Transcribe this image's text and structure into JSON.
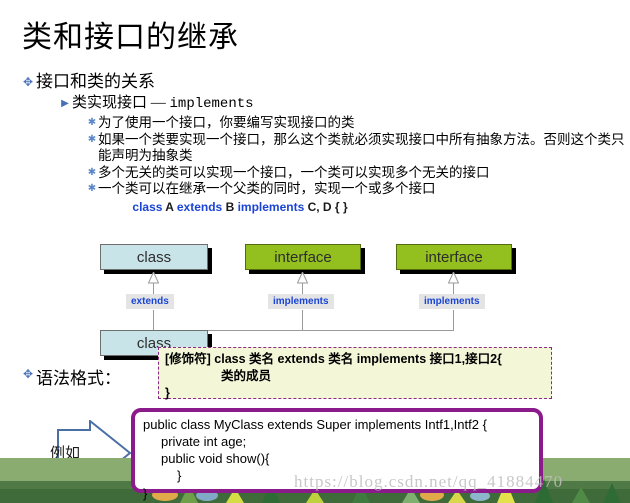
{
  "slide": {
    "title": "类和接口的继承"
  },
  "outline": {
    "level1": {
      "bullet_icon": "cross-arrow-bullet-icon",
      "text": "接口和类的关系"
    },
    "level2": {
      "bullet_icon": "triangle-bullet-icon",
      "text_prefix": "类实现接口 — ",
      "keyword": "implements"
    },
    "level3_items": [
      {
        "bullet_icon": "star-bullet-icon",
        "text": "为了使用一个接口，你要编写实现接口的类"
      },
      {
        "bullet_icon": "star-bullet-icon",
        "text": "如果一个类要实现一个接口，那么这个类就必须实现接口中所有抽象方法。否则这个类只能声明为抽象类"
      },
      {
        "bullet_icon": "star-bullet-icon",
        "text": "多个无关的类可以实现一个接口，一个类可以实现多个无关的接口"
      },
      {
        "bullet_icon": "star-bullet-icon",
        "text": "一个类可以在继承一个父类的同时，实现一个或多个接口"
      }
    ]
  },
  "signature_line": {
    "tokens": [
      {
        "text": "class",
        "kind": "keyword"
      },
      {
        "text": " A ",
        "kind": "identifier"
      },
      {
        "text": "extends",
        "kind": "keyword"
      },
      {
        "text": " B ",
        "kind": "identifier"
      },
      {
        "text": "implements",
        "kind": "keyword"
      },
      {
        "text": " C, D { }",
        "kind": "identifier"
      }
    ],
    "full_text": "class A extends B implements C, D { }"
  },
  "uml": {
    "boxes": [
      {
        "label": "class",
        "kind": "class"
      },
      {
        "label": "interface",
        "kind": "interface"
      },
      {
        "label": "interface",
        "kind": "interface"
      },
      {
        "label": "class",
        "kind": "class"
      }
    ],
    "relation_labels": [
      {
        "label": "extends"
      },
      {
        "label": "implements"
      },
      {
        "label": "implements"
      }
    ],
    "colors": {
      "class_fill": "#c9e4e8",
      "interface_fill": "#93c01f",
      "connector": "#9a9a9a",
      "chip_fill": "#e4e4e4",
      "chip_text": "#1a44d6"
    }
  },
  "syntax_section": {
    "label_bullet_icon": "cross-arrow-bullet-icon",
    "label": "语法格式：",
    "note_lines": [
      "[修饰符] class 类名 extends 类名 implements 接口1,接口2{",
      "类的成员",
      "}"
    ],
    "note_border_color": "#8b2a86",
    "note_fill_color": "#f3f7d8"
  },
  "example_section": {
    "arrow_label": "例如",
    "arrow_color": "#4a6fa5",
    "code_border_color": "#8b1a8b",
    "code_lines": [
      "public class MyClass extends Super implements Intf1,Intf2 {",
      "private int age;",
      "public void show(){",
      "}",
      "}"
    ]
  },
  "watermark": {
    "text": "https://blog.csdn.net/qq_41884470"
  }
}
